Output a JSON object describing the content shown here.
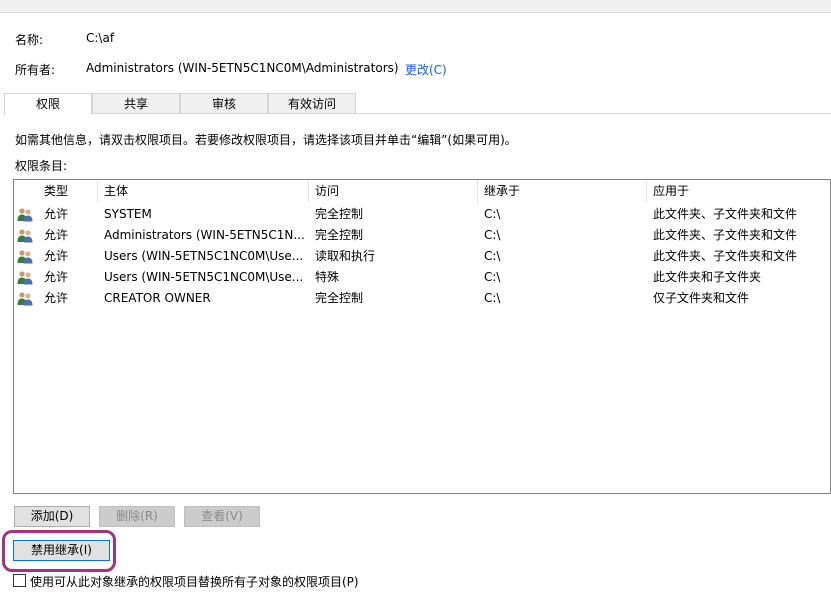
{
  "object": {
    "name_label": "名称:",
    "name_value": "C:\\af",
    "owner_label": "所有者:",
    "owner_value": "Administrators (WIN-5ETN5C1NC0M\\Administrators)",
    "change_link": "更改(C)"
  },
  "tabs": [
    {
      "label": "权限",
      "active": true
    },
    {
      "label": "共享",
      "active": false
    },
    {
      "label": "审核",
      "active": false
    },
    {
      "label": "有效访问",
      "active": false
    }
  ],
  "info_text": "如需其他信息，请双击权限项目。若要修改权限项目，请选择该项目并单击“编辑”(如果可用)。",
  "entries_label": "权限条目:",
  "table": {
    "columns": [
      "类型",
      "主体",
      "访问",
      "继承于",
      "应用于"
    ],
    "rows": [
      {
        "type": "允许",
        "principal": "SYSTEM",
        "access": "完全控制",
        "inherited": "C:\\",
        "applies": "此文件夹、子文件夹和文件"
      },
      {
        "type": "允许",
        "principal": "Administrators (WIN-5ETN5C1N...",
        "access": "完全控制",
        "inherited": "C:\\",
        "applies": "此文件夹、子文件夹和文件"
      },
      {
        "type": "允许",
        "principal": "Users (WIN-5ETN5C1NC0M\\Use...",
        "access": "读取和执行",
        "inherited": "C:\\",
        "applies": "此文件夹、子文件夹和文件"
      },
      {
        "type": "允许",
        "principal": "Users (WIN-5ETN5C1NC0M\\Use...",
        "access": "特殊",
        "inherited": "C:\\",
        "applies": "此文件夹和子文件夹"
      },
      {
        "type": "允许",
        "principal": "CREATOR OWNER",
        "access": "完全控制",
        "inherited": "C:\\",
        "applies": "仅子文件夹和文件"
      }
    ]
  },
  "buttons": {
    "add": "添加(D)",
    "remove": "删除(R)",
    "view": "查看(V)",
    "disable_inheritance": "禁用继承(I)"
  },
  "replace_checkbox": {
    "label": "使用可从此对象继承的权限项目替换所有子对象的权限项目(P)",
    "checked": false
  },
  "colors": {
    "link": "#0a64d6",
    "highlight": "#a3337e"
  }
}
